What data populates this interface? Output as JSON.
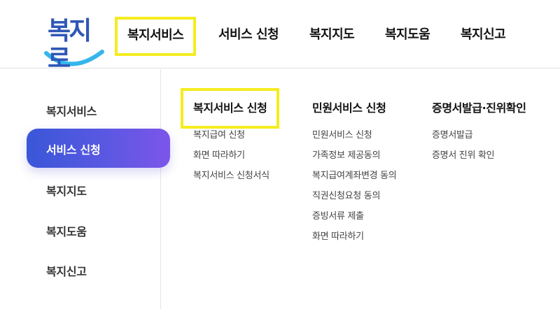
{
  "header": {
    "logo_text": "복지로",
    "nav": [
      {
        "label": "복지서비스",
        "highlighted": true
      },
      {
        "label": "서비스 신청"
      },
      {
        "label": "복지지도"
      },
      {
        "label": "복지도움"
      },
      {
        "label": "복지신고"
      }
    ]
  },
  "sidebar": {
    "items": [
      "복지서비스",
      "서비스 신청",
      "복지지도",
      "복지도움",
      "복지신고"
    ],
    "active_index": 1
  },
  "columns": [
    {
      "title": "복지서비스 신청",
      "highlighted": true,
      "links": [
        "복지급여 신청",
        "화면 따라하기",
        "복지서비스 신청서식"
      ]
    },
    {
      "title": "민원서비스 신청",
      "links": [
        "민원서비스 신청",
        "가족정보 제공동의",
        "복지급여계좌변경 동의",
        "직권신청요청 동의",
        "증빙서류 제출",
        "화면 따라하기"
      ]
    },
    {
      "title": "증명서발급·진위확인",
      "links": [
        "증명서발급",
        "증명서 진위 확인"
      ]
    }
  ],
  "colors": {
    "accent_start": "#3a57d8",
    "accent_end": "#7d55ea",
    "highlight": "#f5ec1f",
    "logo_blue": "#2f57b8",
    "logo_smile": "#35b6ec"
  }
}
